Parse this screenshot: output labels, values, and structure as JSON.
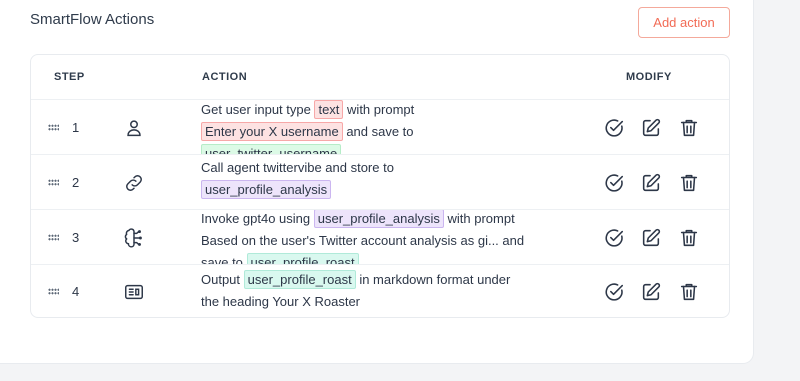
{
  "header": {
    "title": "SmartFlow Actions",
    "add_button": "Add action"
  },
  "table": {
    "columns": {
      "step": "STEP",
      "action": "ACTION",
      "modify": "MODIFY"
    },
    "rows": [
      {
        "step": "1",
        "type_icon": "user-icon",
        "parts": [
          {
            "t": "text",
            "v": "Get user input type"
          },
          {
            "t": "tag",
            "c": "red",
            "v": "text"
          },
          {
            "t": "text",
            "v": "with prompt"
          },
          {
            "t": "br"
          },
          {
            "t": "tag",
            "c": "red",
            "v": "Enter your X username"
          },
          {
            "t": "text",
            "v": "and save to"
          },
          {
            "t": "br"
          },
          {
            "t": "tag",
            "c": "green",
            "v": "user_twitter_username"
          }
        ]
      },
      {
        "step": "2",
        "type_icon": "link-icon",
        "parts": [
          {
            "t": "text",
            "v": "Call agent twittervibe and store to"
          },
          {
            "t": "br"
          },
          {
            "t": "tag",
            "c": "purple",
            "v": "user_profile_analysis"
          }
        ]
      },
      {
        "step": "3",
        "type_icon": "brain-circuit-icon",
        "parts": [
          {
            "t": "text",
            "v": "Invoke gpt4o using"
          },
          {
            "t": "tag",
            "c": "purple",
            "v": "user_profile_analysis"
          },
          {
            "t": "text",
            "v": "with prompt"
          },
          {
            "t": "br"
          },
          {
            "t": "text",
            "v": "Based on the user's Twitter account analysis as gi... and"
          },
          {
            "t": "br"
          },
          {
            "t": "text",
            "v": "save to"
          },
          {
            "t": "tag",
            "c": "teal",
            "v": "user_profile_roast"
          }
        ]
      },
      {
        "step": "4",
        "type_icon": "output-panel-icon",
        "parts": [
          {
            "t": "text",
            "v": "Output"
          },
          {
            "t": "tag",
            "c": "teal",
            "v": "user_profile_roast"
          },
          {
            "t": "text",
            "v": "in markdown format under"
          },
          {
            "t": "br"
          },
          {
            "t": "text",
            "v": "the heading Your X Roaster"
          }
        ]
      }
    ],
    "modify_icons": [
      "check-circle-icon",
      "edit-icon",
      "trash-icon"
    ]
  },
  "colors": {
    "accent": "#f26b55",
    "tag_red": "#fde2e2",
    "tag_green": "#dcfae6",
    "tag_purple": "#ede4fb",
    "tag_teal": "#d9f8ef"
  }
}
